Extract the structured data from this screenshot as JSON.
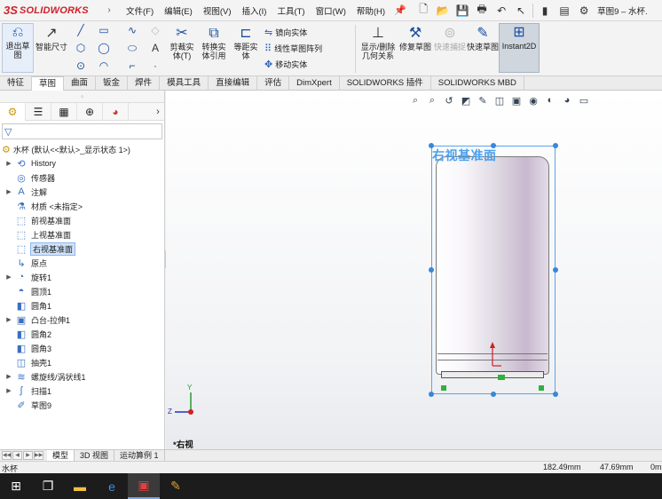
{
  "app": {
    "logo_mark": "3S",
    "logo_text": "SOLIDWORKS",
    "menu": [
      "文件(F)",
      "编辑(E)",
      "视图(V)",
      "插入(I)",
      "工具(T)",
      "窗口(W)",
      "帮助(H)"
    ],
    "doc_title": "草图9 – 水杯.",
    "qa_icons": [
      "new-icon",
      "open-icon",
      "save-icon",
      "print-icon",
      "undo-icon",
      "select-icon",
      "traffic-light-icon",
      "file-properties-icon",
      "options-icon"
    ]
  },
  "ribbon": {
    "exit_sketch": "退出草图",
    "smart_dimension": "智能尺寸",
    "trim": "剪裁实体(T)",
    "convert": "转换实体引用",
    "offset": "等距实体",
    "mirror": "镜向实体",
    "linear_pattern": "线性草图阵列",
    "move": "移动实体",
    "display_delete": "显示/删除几何关系",
    "repair": "修复草图",
    "quick_snap": "快速捕捉",
    "rapid_sketch": "快速草图",
    "instant2d": "Instant2D"
  },
  "tabs": [
    "特征",
    "草图",
    "曲面",
    "钣金",
    "焊件",
    "模具工具",
    "直接编辑",
    "评估",
    "DimXpert",
    "SOLIDWORKS 插件",
    "SOLIDWORKS MBD"
  ],
  "active_tab": "草图",
  "tree": {
    "root": "水杯  (默认<<默认>_显示状态 1>)",
    "items": [
      {
        "label": "History",
        "icon": "history-icon",
        "arrow": true
      },
      {
        "label": "传感器",
        "icon": "sensor-icon",
        "arrow": false
      },
      {
        "label": "注解",
        "icon": "annotation-icon",
        "arrow": true
      },
      {
        "label": "材质 <未指定>",
        "icon": "material-icon",
        "arrow": false
      },
      {
        "label": "前视基准面",
        "icon": "plane-icon",
        "arrow": false
      },
      {
        "label": "上视基准面",
        "icon": "plane-icon",
        "arrow": false
      },
      {
        "label": "右视基准面",
        "icon": "plane-icon",
        "arrow": false,
        "selected": true
      },
      {
        "label": "原点",
        "icon": "origin-icon",
        "arrow": false
      },
      {
        "label": "旋转1",
        "icon": "revolve-icon",
        "arrow": true
      },
      {
        "label": "圆顶1",
        "icon": "dome-icon",
        "arrow": false
      },
      {
        "label": "圆角1",
        "icon": "fillet-icon",
        "arrow": false
      },
      {
        "label": "凸台-拉伸1",
        "icon": "extrude-icon",
        "arrow": true
      },
      {
        "label": "圆角2",
        "icon": "fillet-icon",
        "arrow": false
      },
      {
        "label": "圆角3",
        "icon": "fillet-icon",
        "arrow": false
      },
      {
        "label": "抽壳1",
        "icon": "shell-icon",
        "arrow": false
      },
      {
        "label": "螺旋线/涡状线1",
        "icon": "helix-icon",
        "arrow": true
      },
      {
        "label": "扫描1",
        "icon": "sweep-icon",
        "arrow": true
      },
      {
        "label": "草图9",
        "icon": "sketch-icon",
        "arrow": false
      }
    ]
  },
  "graphics": {
    "plane_label": "右视基准面",
    "view_label": "*右视",
    "triad": {
      "y": "Y",
      "z": "Z"
    }
  },
  "bottom_tabs": [
    "模型",
    "3D 视图",
    "运动算例 1"
  ],
  "active_bottom_tab": "模型",
  "status": {
    "left": "水杯",
    "v1": "182.49mm",
    "v2": "47.69mm",
    "v3": "0m"
  }
}
